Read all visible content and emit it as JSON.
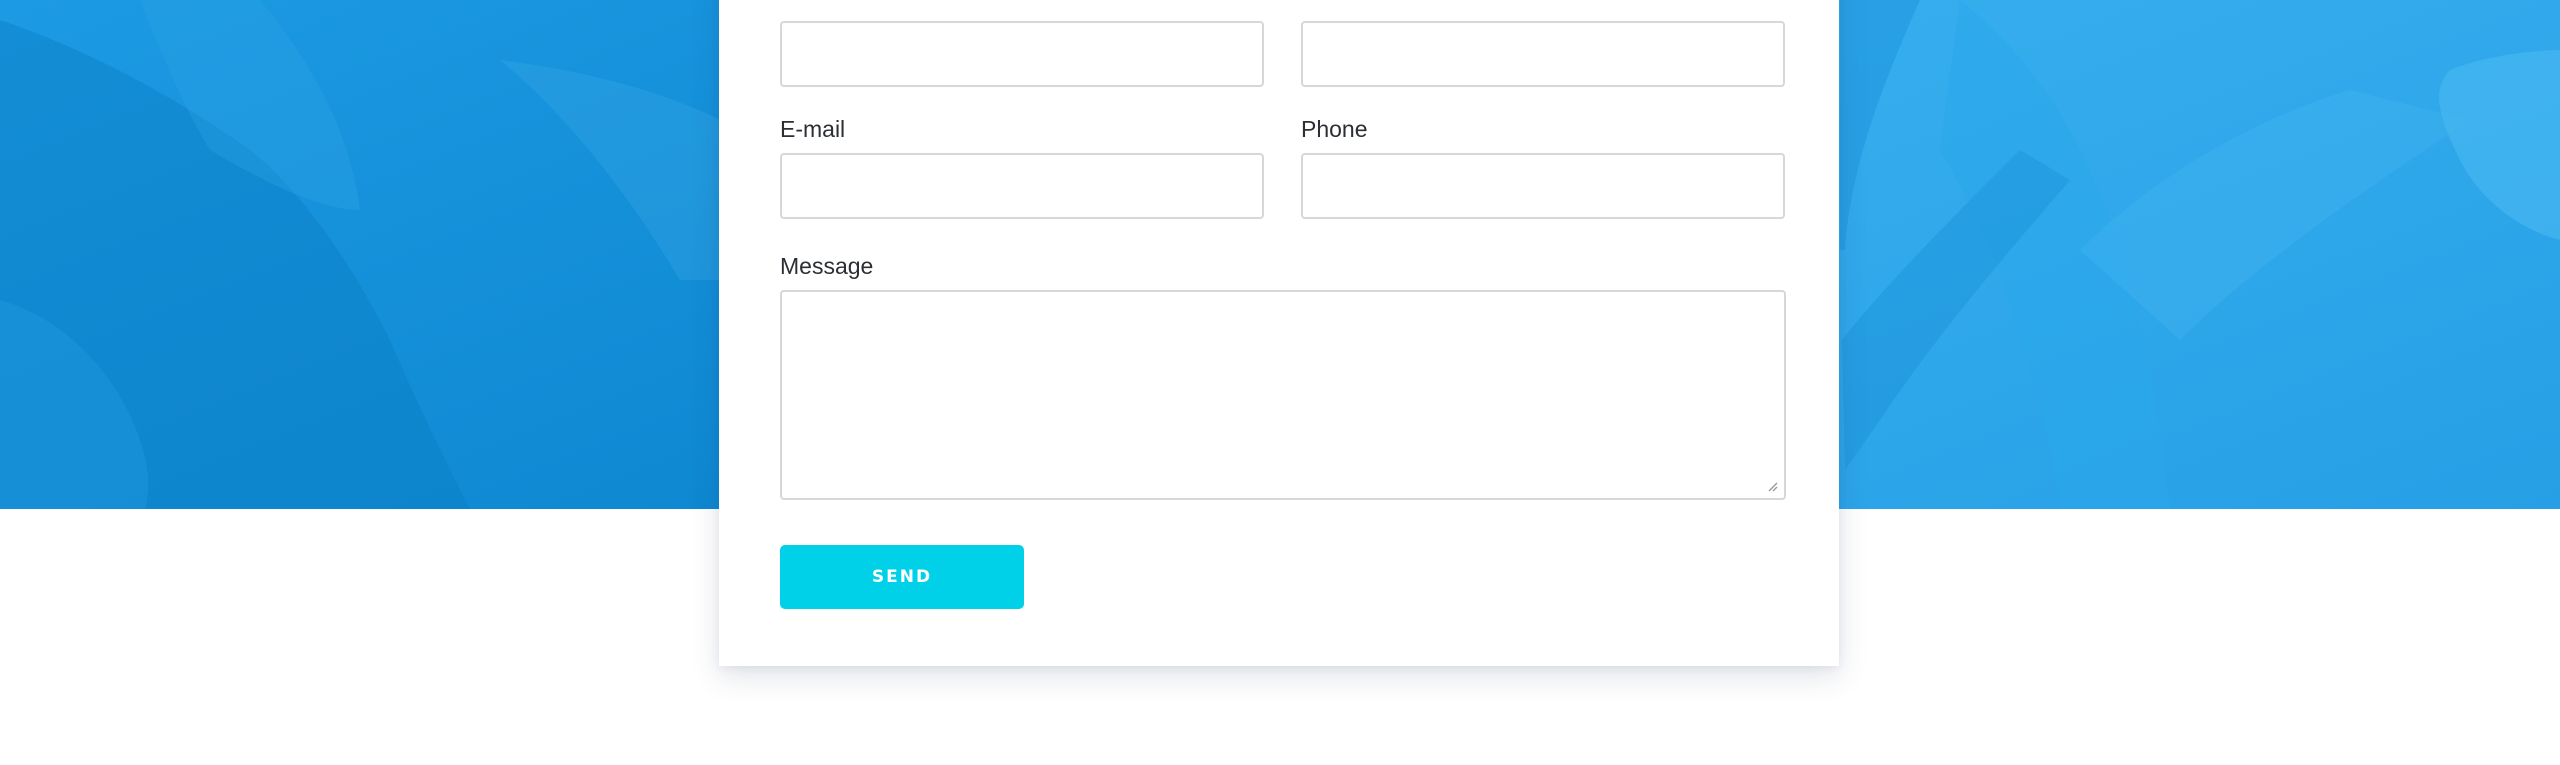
{
  "form": {
    "fields": {
      "email_label": "E-mail",
      "phone_label": "Phone",
      "message_label": "Message"
    },
    "send_label": "SEND"
  },
  "theme": {
    "hero_blue": "#0a8fd8",
    "button_cyan": "#00d1e8",
    "card_bg": "#ffffff",
    "border": "#d7d7d7"
  }
}
